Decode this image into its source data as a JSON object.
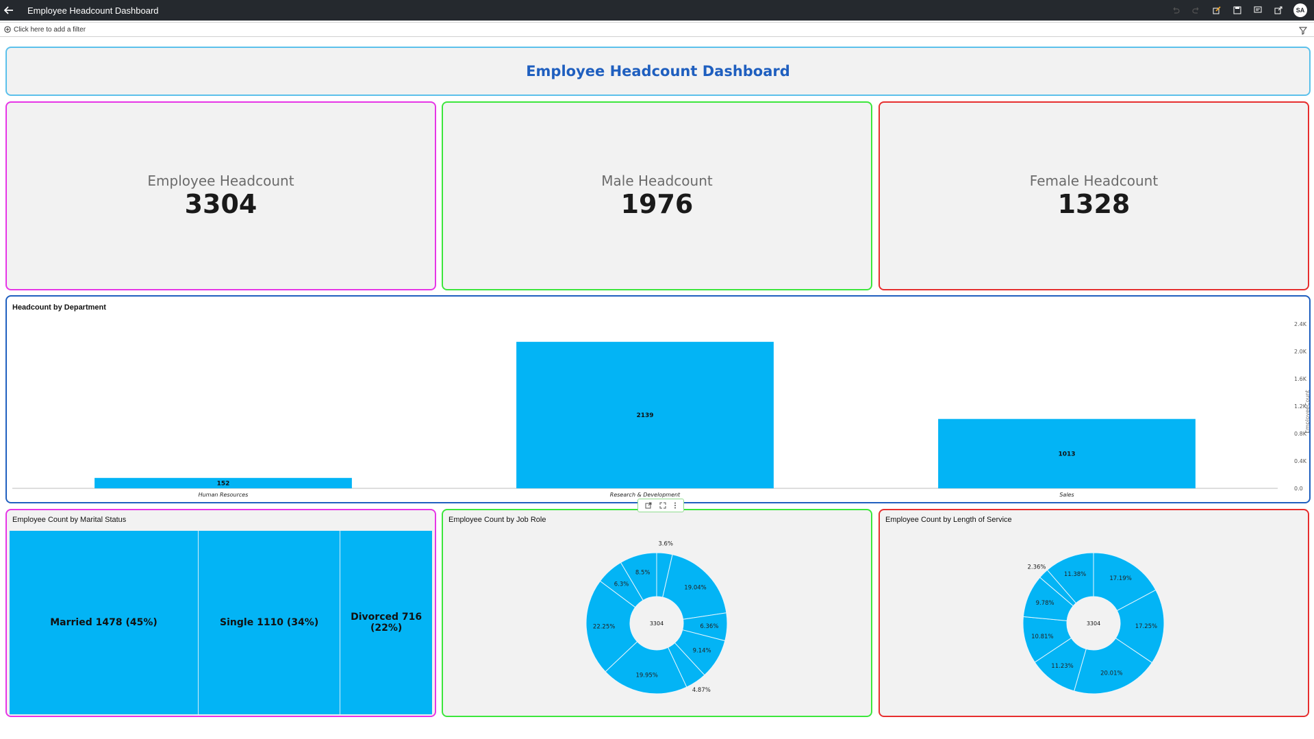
{
  "topbar": {
    "title": "Employee Headcount Dashboard",
    "avatar": "SA",
    "icons": [
      "undo-icon",
      "redo-icon",
      "edit-icon",
      "save-icon",
      "comment-icon",
      "share-icon"
    ]
  },
  "filterbar": {
    "placeholder": "Click here to add a filter"
  },
  "dashboard": {
    "title": "Employee Headcount Dashboard"
  },
  "kpis": [
    {
      "label": "Employee Headcount",
      "value": "3304"
    },
    {
      "label": "Male Headcount",
      "value": "1976"
    },
    {
      "label": "Female Headcount",
      "value": "1328"
    }
  ],
  "colors": {
    "bar": "#03b4f5",
    "accent_title": "#1f5fbf",
    "pink": "#e635e6",
    "green": "#3ce63c",
    "red": "#e62e2e"
  },
  "chart_data": [
    {
      "type": "bar",
      "title": "Headcount by Department",
      "categories": [
        "Human Resources",
        "Research & Development",
        "Sales"
      ],
      "values": [
        152,
        2139,
        1013
      ],
      "data_labels": [
        "152",
        "2139",
        "1013"
      ],
      "ylabel": "EmployeeCount",
      "ylim": [
        0,
        2400
      ],
      "yticks": [
        0,
        400,
        800,
        1200,
        1600,
        2000,
        2400
      ],
      "ytick_labels": [
        "0.0",
        "0.4K",
        "0.8K",
        "1.2K",
        "1.6K",
        "2.0K",
        "2.4K"
      ],
      "yaxis_position": "right"
    },
    {
      "type": "treemap",
      "title": "Employee Count by Marital Status",
      "categories": [
        "Married",
        "Single",
        "Divorced"
      ],
      "values": [
        1478,
        1110,
        716
      ],
      "labels": [
        "Married 1478 (45%)",
        "Single 1110 (34%)",
        "Divorced 716 (22%)"
      ]
    },
    {
      "type": "pie",
      "title": "Employee Count by Job Role",
      "center_label": "3304",
      "slice_labels": [
        "3.6%",
        "19.04%",
        "6.36%",
        "9.14%",
        "4.87%",
        "19.95%",
        "22.25%",
        "6.3%",
        "8.5%"
      ],
      "values": [
        3.6,
        19.04,
        6.36,
        9.14,
        4.87,
        19.95,
        22.25,
        6.3,
        8.5
      ]
    },
    {
      "type": "pie",
      "title": "Employee Count by Length of Service",
      "center_label": "3304",
      "slice_labels": [
        "17.19%",
        "17.25%",
        "20.01%",
        "11.23%",
        "10.81%",
        "9.78%",
        "2.36%",
        "11.38%"
      ],
      "values": [
        17.19,
        17.25,
        20.01,
        11.23,
        10.81,
        9.78,
        2.36,
        11.38
      ]
    }
  ]
}
